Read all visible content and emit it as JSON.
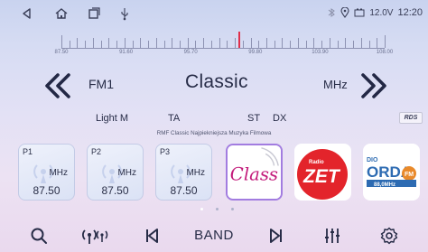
{
  "status": {
    "voltage": "12.0V",
    "time": "12:20"
  },
  "scale": {
    "ticks": [
      "87.50",
      "91.60",
      "95.70",
      "99.80",
      "103.90",
      "108.00"
    ],
    "current_value": 98.8
  },
  "tuner": {
    "band": "FM1",
    "station_name": "Classic",
    "unit": "MHz",
    "flag_station": "Light M",
    "flag_ta": "TA",
    "flag_st": "ST",
    "flag_dx": "DX",
    "rds": "RDS",
    "radio_text": "RMF Classic Najpiekniejsza Muzyka Filmowa"
  },
  "presets": [
    {
      "label": "P1",
      "unit": "MHz",
      "freq": "87.50"
    },
    {
      "label": "P2",
      "unit": "MHz",
      "freq": "87.50"
    },
    {
      "label": "P3",
      "unit": "MHz",
      "freq": "87.50"
    }
  ],
  "logos": [
    {
      "name": "Classic",
      "color": "#c31b7b"
    },
    {
      "name": "Radio ZET",
      "color": "#e3242b"
    },
    {
      "name": "Radio Olsztyn ORDA FM",
      "color": "#2d6bb2",
      "freq": "88,0MHz"
    }
  ],
  "pager": {
    "count": 3,
    "active": 0
  },
  "bottom": {
    "band_label": "BAND"
  }
}
